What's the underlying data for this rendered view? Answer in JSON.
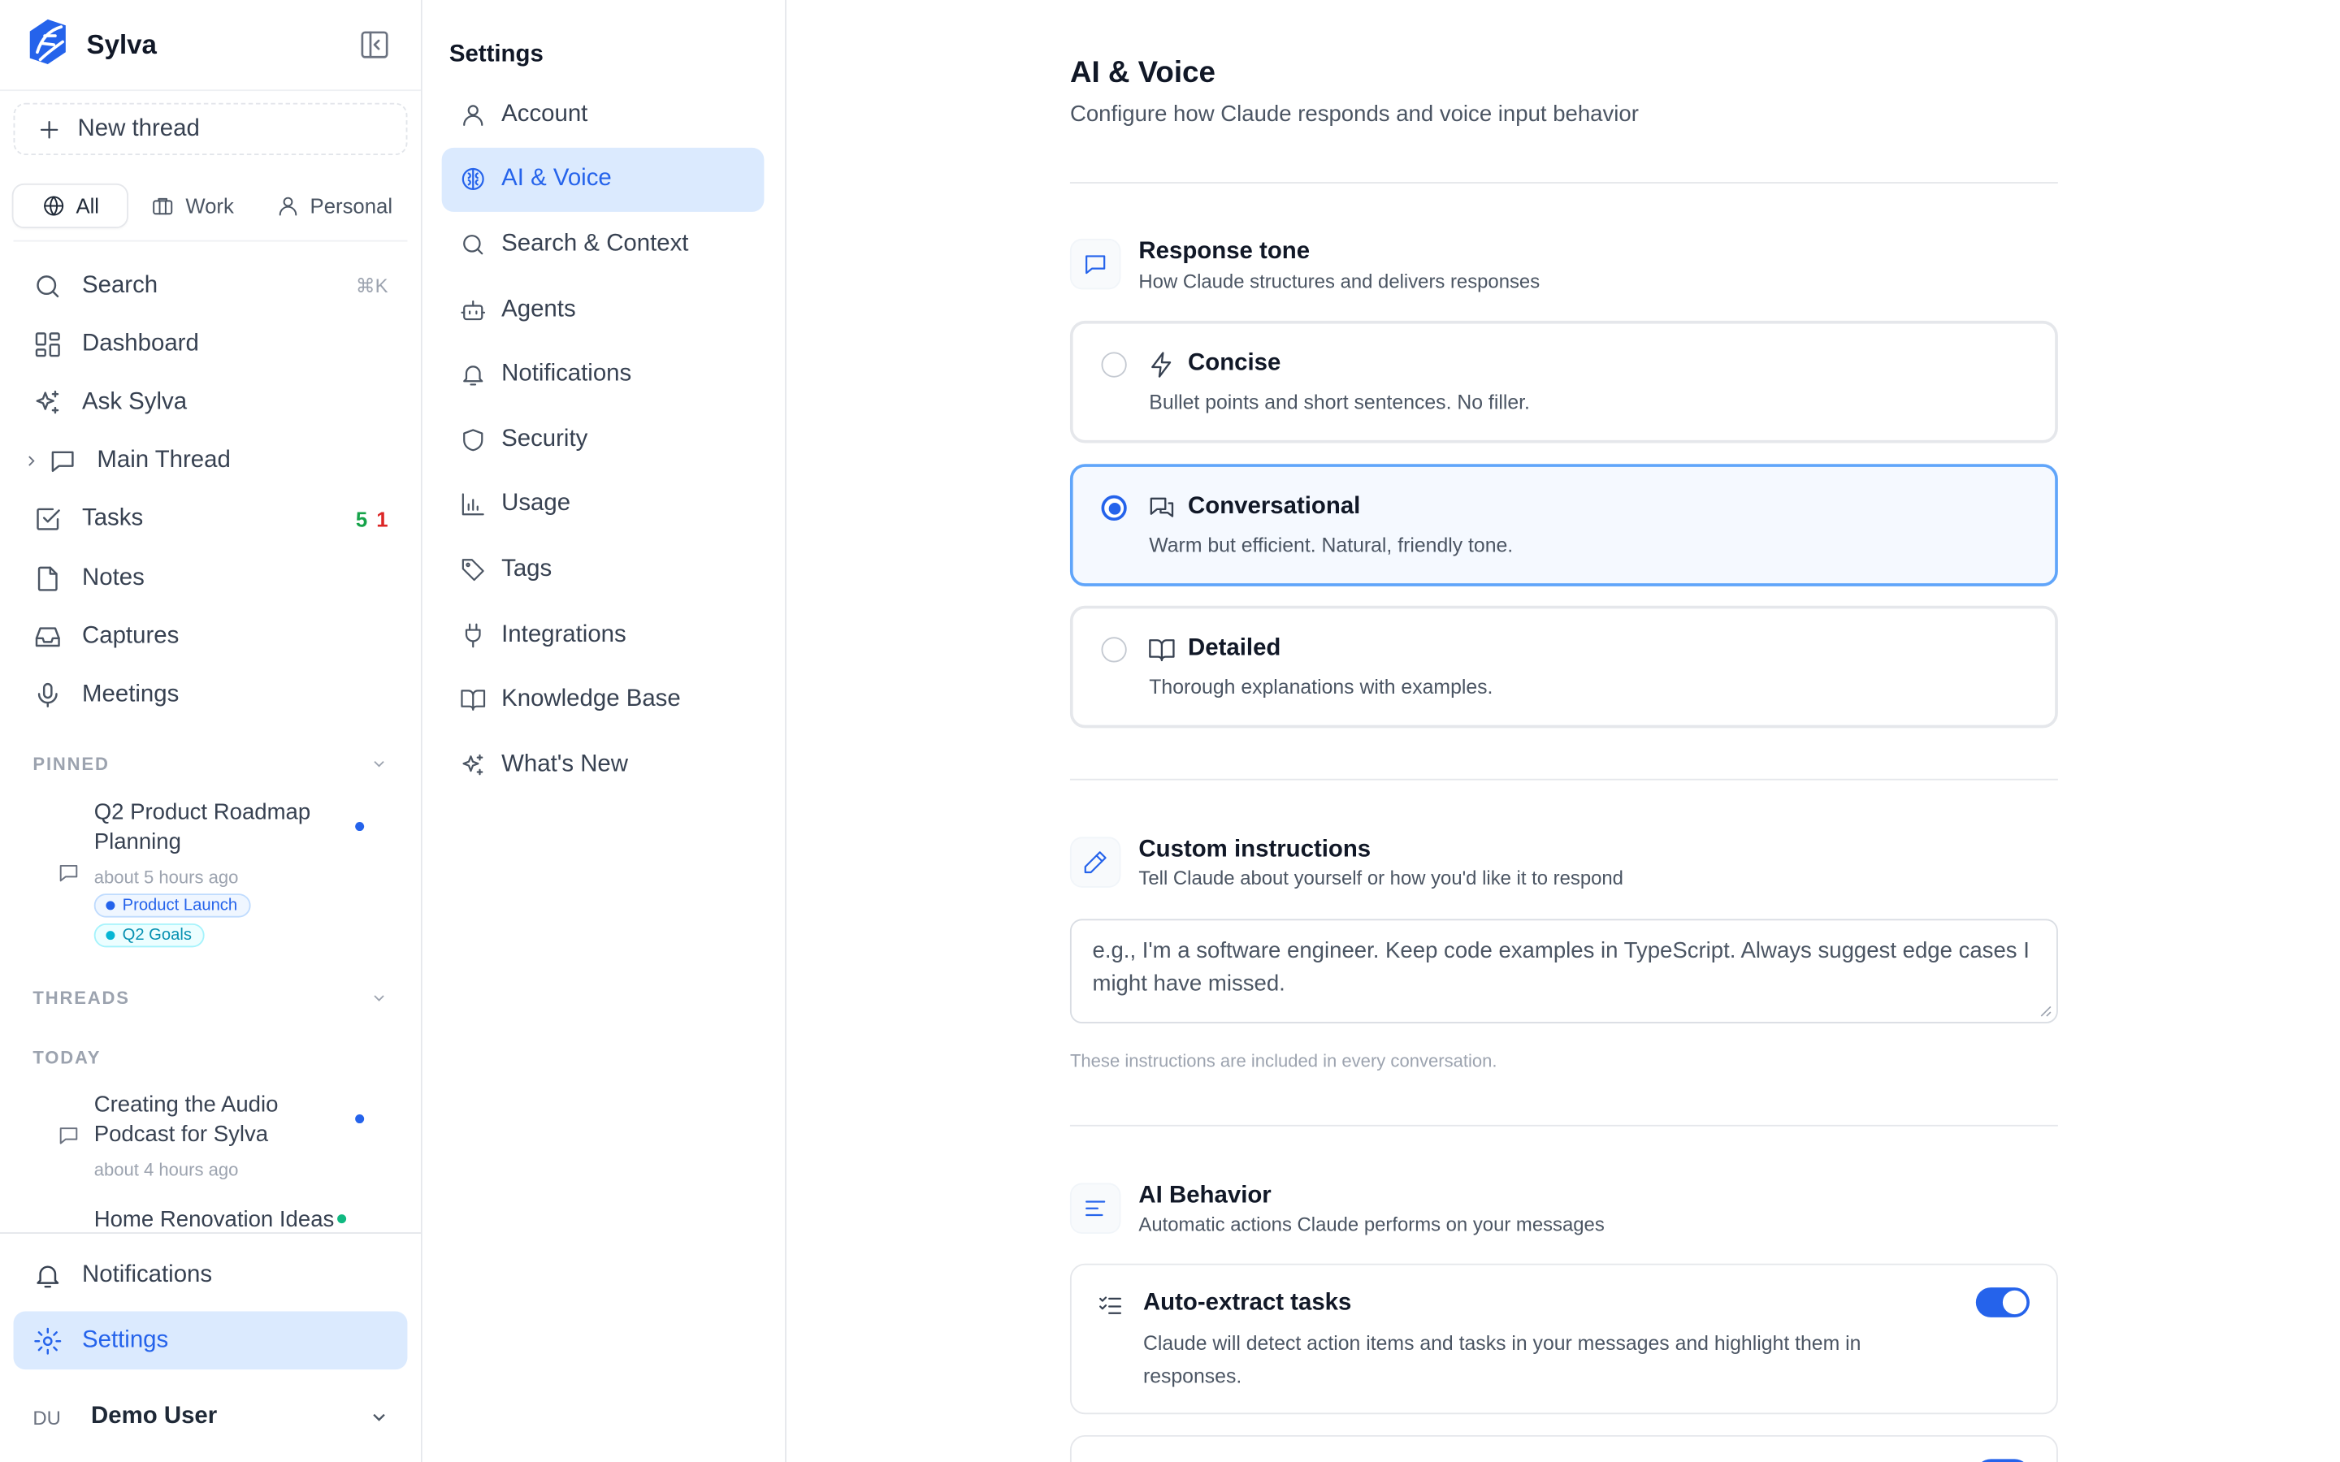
{
  "app": {
    "name": "Sylva"
  },
  "sidebar": {
    "new_thread": "New thread",
    "filters": [
      {
        "label": "All",
        "icon": "globe-icon",
        "active": true
      },
      {
        "label": "Work",
        "icon": "briefcase-icon",
        "active": false
      },
      {
        "label": "Personal",
        "icon": "user-icon",
        "active": false
      }
    ],
    "nav": [
      {
        "label": "Search",
        "icon": "search-icon",
        "shortcut": "⌘K"
      },
      {
        "label": "Dashboard",
        "icon": "dashboard-icon"
      },
      {
        "label": "Ask Sylva",
        "icon": "sparkles-icon"
      },
      {
        "label": "Main Thread",
        "icon": "message-icon"
      },
      {
        "label": "Tasks",
        "icon": "checkbox-icon",
        "count_open": "5",
        "count_overdue": "1"
      },
      {
        "label": "Notes",
        "icon": "file-icon"
      },
      {
        "label": "Captures",
        "icon": "inbox-icon"
      },
      {
        "label": "Meetings",
        "icon": "microphone-icon"
      }
    ],
    "pinned": {
      "heading": "PINNED",
      "items": [
        {
          "title": "Q2 Product Roadmap Planning",
          "time": "about 5 hours ago",
          "tags": [
            "Product Launch",
            "Q2 Goals"
          ]
        }
      ]
    },
    "threads": {
      "heading": "THREADS",
      "group": "TODAY",
      "items": [
        {
          "title": "Creating the Audio Podcast for Sylva",
          "time": "about 4 hours ago"
        },
        {
          "title": "Home Renovation Ideas",
          "time": ""
        }
      ]
    },
    "footer": {
      "notifications": "Notifications",
      "settings": "Settings",
      "user_initials": "DU",
      "user_name": "Demo User"
    }
  },
  "settings_nav": {
    "title": "Settings",
    "items": [
      {
        "label": "Account",
        "icon": "user-icon"
      },
      {
        "label": "AI & Voice",
        "icon": "brain-icon",
        "active": true
      },
      {
        "label": "Search & Context",
        "icon": "search-icon"
      },
      {
        "label": "Agents",
        "icon": "bot-icon"
      },
      {
        "label": "Notifications",
        "icon": "bell-icon"
      },
      {
        "label": "Security",
        "icon": "shield-icon"
      },
      {
        "label": "Usage",
        "icon": "bar-chart-icon"
      },
      {
        "label": "Tags",
        "icon": "tag-icon"
      },
      {
        "label": "Integrations",
        "icon": "plug-icon"
      },
      {
        "label": "Knowledge Base",
        "icon": "book-icon"
      },
      {
        "label": "What's New",
        "icon": "sparkles-icon"
      }
    ]
  },
  "main": {
    "title": "AI & Voice",
    "subtitle": "Configure how Claude responds and voice input behavior",
    "response_tone": {
      "title": "Response tone",
      "subtitle": "How Claude structures and delivers responses",
      "options": [
        {
          "label": "Concise",
          "desc": "Bullet points and short sentences. No filler.",
          "selected": false
        },
        {
          "label": "Conversational",
          "desc": "Warm but efficient. Natural, friendly tone.",
          "selected": true
        },
        {
          "label": "Detailed",
          "desc": "Thorough explanations with examples.",
          "selected": false
        }
      ]
    },
    "custom_instructions": {
      "title": "Custom instructions",
      "subtitle": "Tell Claude about yourself or how you'd like it to respond",
      "placeholder": "e.g., I'm a software engineer. Keep code examples in TypeScript. Always suggest edge cases I might have missed.",
      "hint": "These instructions are included in every conversation."
    },
    "ai_behavior": {
      "title": "AI Behavior",
      "subtitle": "Automatic actions Claude performs on your messages",
      "toggles": [
        {
          "title": "Auto-extract tasks",
          "desc": "Claude will detect action items and tasks in your messages and highlight them in responses.",
          "enabled": true
        }
      ]
    }
  },
  "colors": {
    "accent": "#2563eb",
    "accent_bg": "#dbeafe",
    "success": "#16a34a",
    "danger": "#dc2626"
  }
}
